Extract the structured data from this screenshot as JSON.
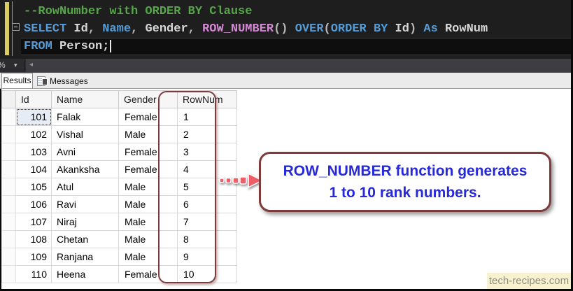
{
  "editor": {
    "zoom_label": "%",
    "palette": {
      "keyword": "#569cd6",
      "identifier": "#d8d8d8",
      "function": "#d38ad3",
      "punctuation": "#b8b8b8",
      "comment": "#57a64a",
      "background": "#1e1e1e",
      "change_bar": "#d9cb60"
    },
    "lines": [
      {
        "tokens": [
          {
            "text": "--RowNumber with ORDER BY Clause",
            "type": "comment"
          }
        ]
      },
      {
        "collapsible": true,
        "tokens": [
          {
            "text": "SELECT",
            "type": "keyword"
          },
          {
            "text": " Id",
            "type": "identifier"
          },
          {
            "text": ", ",
            "type": "punctuation"
          },
          {
            "text": "Name",
            "type": "keyword"
          },
          {
            "text": ", ",
            "type": "punctuation"
          },
          {
            "text": "Gender",
            "type": "identifier"
          },
          {
            "text": ", ",
            "type": "punctuation"
          },
          {
            "text": "ROW_NUMBER",
            "type": "function"
          },
          {
            "text": "() ",
            "type": "punctuation"
          },
          {
            "text": "OVER",
            "type": "keyword"
          },
          {
            "text": "(",
            "type": "punctuation"
          },
          {
            "text": "ORDER BY",
            "type": "keyword"
          },
          {
            "text": " Id",
            "type": "identifier"
          },
          {
            "text": ") ",
            "type": "punctuation"
          },
          {
            "text": "As",
            "type": "keyword"
          },
          {
            "text": " RowNum",
            "type": "identifier"
          }
        ]
      },
      {
        "current": true,
        "caret": true,
        "tokens": [
          {
            "text": "FROM",
            "type": "keyword"
          },
          {
            "text": " Person;",
            "type": "identifier"
          }
        ]
      }
    ]
  },
  "results_tabs": {
    "results": "Results",
    "messages": "Messages"
  },
  "grid": {
    "columns": [
      "Id",
      "Name",
      "Gender",
      "RowNum"
    ],
    "rows": [
      [
        "101",
        "Falak",
        "Female",
        "1"
      ],
      [
        "102",
        "Vishal",
        "Male",
        "2"
      ],
      [
        "103",
        "Avni",
        "Female",
        "3"
      ],
      [
        "104",
        "Akanksha",
        "Female",
        "4"
      ],
      [
        "105",
        "Atul",
        "Male",
        "5"
      ],
      [
        "106",
        "Ravi",
        "Male",
        "6"
      ],
      [
        "107",
        "Niraj",
        "Male",
        "7"
      ],
      [
        "108",
        "Chetan",
        "Male",
        "8"
      ],
      [
        "109",
        "Ranjana",
        "Male",
        "9"
      ],
      [
        "110",
        "Heena",
        "Female",
        "10"
      ]
    ],
    "highlight_color": "#7d3b3b"
  },
  "callout": {
    "line1": "ROW_NUMBER function generates",
    "line2": "1 to 10 rank numbers.",
    "text_color": "#2629da",
    "border_color": "#7d3b3b",
    "arrow_color": "#ef5e68"
  },
  "watermark": {
    "text": "tech-recipes.com"
  }
}
